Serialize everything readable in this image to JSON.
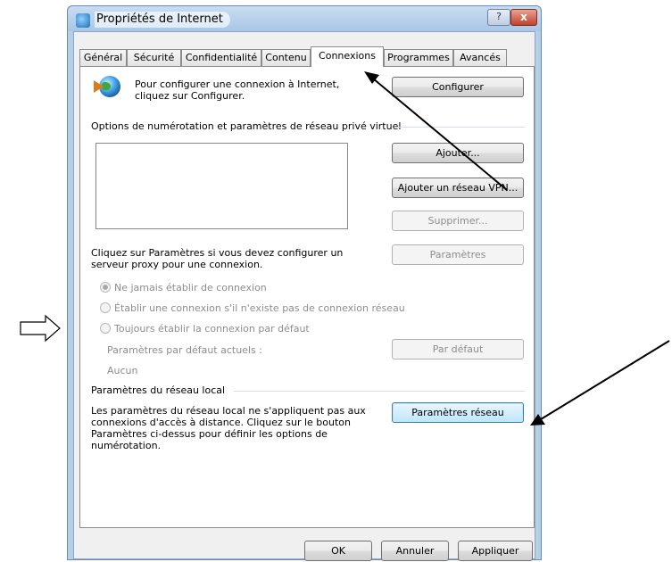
{
  "window": {
    "title": "Propriétés de Internet",
    "help_label": "?",
    "close_label": "x"
  },
  "tabs": [
    {
      "label": "Général"
    },
    {
      "label": "Sécurité"
    },
    {
      "label": "Confidentialité"
    },
    {
      "label": "Contenu"
    },
    {
      "label": "Connexions",
      "active": true
    },
    {
      "label": "Programmes"
    },
    {
      "label": "Avancés"
    }
  ],
  "setup": {
    "text": "Pour configurer une connexion à Internet, cliquez sur Configurer.",
    "button": "Configurer"
  },
  "dialup": {
    "group_title": "Options de numérotation et paramètres de réseau privé virtuel",
    "add_button": "Ajouter...",
    "add_vpn_button": "Ajouter un réseau VPN...",
    "remove_button": "Supprimer...",
    "proxy_text": "Cliquez sur Paramètres si vous devez configurer un serveur proxy pour une connexion.",
    "settings_button": "Paramètres",
    "radio_never": "Ne jamais établir de connexion",
    "radio_when_none": "Établir une connexion s'il n'existe pas de connexion réseau",
    "radio_always": "Toujours établir la connexion par défaut",
    "current_default_label": "Paramètres par défaut actuels :",
    "current_default_value": "Aucun",
    "set_default_button": "Par défaut"
  },
  "lan": {
    "group_title": "Paramètres du réseau local",
    "text": "Les paramètres du réseau local ne s'appliquent pas aux connexions d'accès à distance. Cliquez sur le bouton Paramètres ci-dessus pour définir les options de numérotation.",
    "button": "Paramètres réseau"
  },
  "footer": {
    "ok": "OK",
    "cancel": "Annuler",
    "apply": "Appliquer"
  },
  "colors": {
    "title_bg": "#b4cfe8",
    "close_red": "#c2402a",
    "focus_blue": "#3c7fb1"
  }
}
